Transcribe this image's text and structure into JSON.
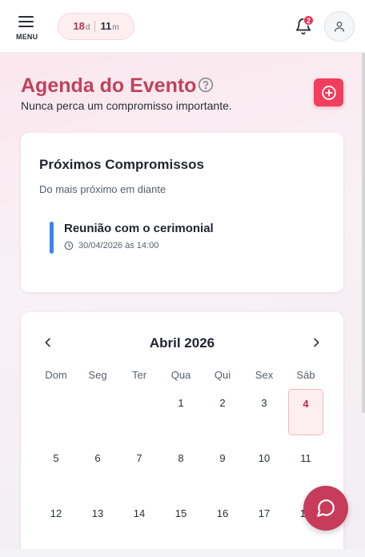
{
  "header": {
    "menu_label": "MENU",
    "countdown": {
      "days": "18",
      "days_unit": "d",
      "minutes": "11",
      "minutes_unit": "m"
    },
    "notifications_count": "2"
  },
  "page": {
    "title": "Agenda do Evento",
    "subtitle": "Nunca perca um compromisso importante."
  },
  "upcoming": {
    "title": "Próximos Compromissos",
    "subtitle": "Do mais próximo em diante",
    "items": [
      {
        "title": "Reunião com o cerimonial",
        "datetime": "30/04/2026 às 14:00",
        "color": "#3b82f6"
      }
    ]
  },
  "calendar": {
    "month_label": "Abril 2026",
    "weekdays": [
      "Dom",
      "Seg",
      "Ter",
      "Qua",
      "Qui",
      "Sex",
      "Sáb"
    ],
    "weeks": [
      [
        "",
        "",
        "",
        "1",
        "2",
        "3",
        "4"
      ],
      [
        "5",
        "6",
        "7",
        "8",
        "9",
        "10",
        "11"
      ],
      [
        "12",
        "13",
        "14",
        "15",
        "16",
        "17",
        "18"
      ]
    ],
    "today": "4"
  },
  "colors": {
    "accent": "#c2415c",
    "add_button": "#f23d5c",
    "chat_button": "#c63c5a"
  }
}
